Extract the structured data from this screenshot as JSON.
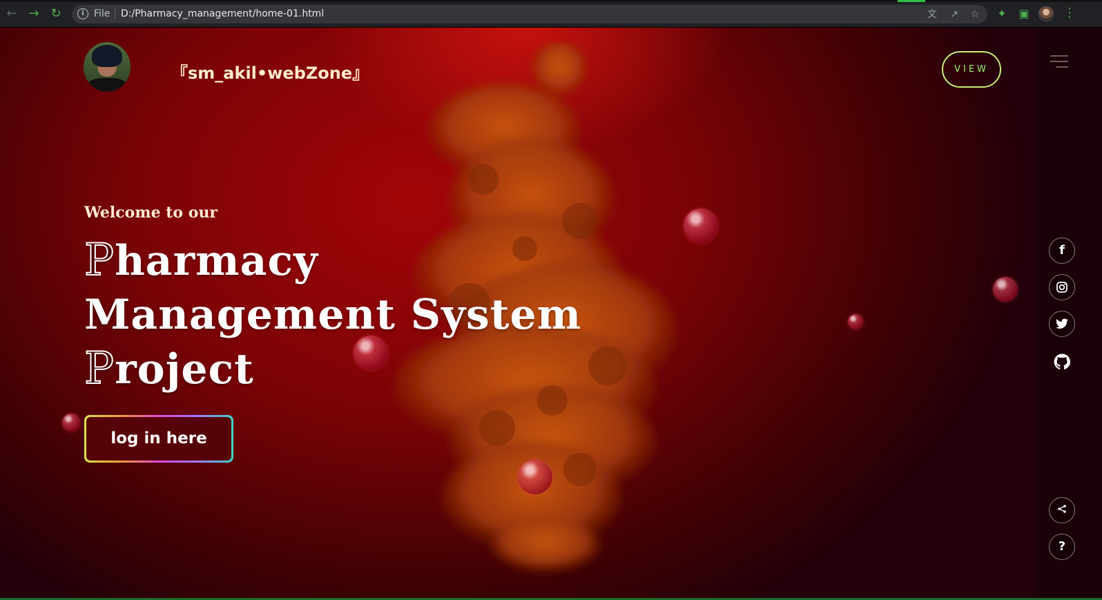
{
  "browser": {
    "back_icon": "arrow-left-icon",
    "forward_icon": "arrow-right-icon",
    "reload_icon": "reload-icon",
    "scheme": "File",
    "url": "D:/Pharmacy_management/home-01.html",
    "omnibox_icons": [
      "translate-icon",
      "share-icon",
      "star-icon"
    ],
    "extension_icons": [
      "puzzle-icon",
      "sidebar-icon"
    ],
    "colors": {
      "toolbar_bg": "#202124",
      "omnibox_bg": "#35363a",
      "accent_green": "#4caf50"
    }
  },
  "header": {
    "brand": "『sm_akil•webZone』",
    "view_button": "VIEW"
  },
  "hero": {
    "welcome": "Welcome to our",
    "title_lines": [
      {
        "cap": "P",
        "rest": "harmacy"
      },
      {
        "cap": "",
        "rest": "Management System"
      },
      {
        "cap": "P",
        "rest": "roject"
      }
    ],
    "login_button": "log in here"
  },
  "sidebar": {
    "menu_icon": "hamburger-menu-icon",
    "social": [
      {
        "name": "facebook-icon",
        "glyph": "f"
      },
      {
        "name": "instagram-icon",
        "glyph": ""
      },
      {
        "name": "twitter-icon",
        "glyph": ""
      },
      {
        "name": "github-icon",
        "glyph": ""
      }
    ],
    "share_icon": "share-icon",
    "help_label": "?"
  },
  "theme": {
    "background_red": "#a30508",
    "smoke_orange": "#d2550a",
    "view_border": "#c7f07a",
    "view_text": "#9ff06e",
    "heading_cream": "#fde9d5"
  }
}
